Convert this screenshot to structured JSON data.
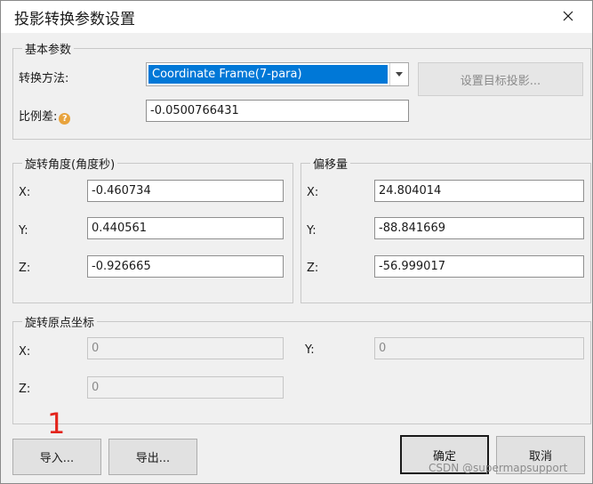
{
  "window": {
    "title": "投影转换参数设置"
  },
  "basic": {
    "legend": "基本参数",
    "method_label": "转换方法:",
    "method_value": "Coordinate Frame(7-para)",
    "scale_label": "比例差:",
    "scale_value": "-0.0500766431",
    "target_button": "设置目标投影..."
  },
  "rotation": {
    "legend": "旋转角度(角度秒)",
    "x_label": "X:",
    "x_value": "-0.460734",
    "y_label": "Y:",
    "y_value": "0.440561",
    "z_label": "Z:",
    "z_value": "-0.926665"
  },
  "offset": {
    "legend": "偏移量",
    "x_label": "X:",
    "x_value": "24.804014",
    "y_label": "Y:",
    "y_value": "-88.841669",
    "z_label": "Z:",
    "z_value": "-56.999017"
  },
  "origin": {
    "legend": "旋转原点坐标",
    "x_label": "X:",
    "x_value": "0",
    "y_label": "Y:",
    "y_value": "0",
    "z_label": "Z:",
    "z_value": "0"
  },
  "footer": {
    "import": "导入...",
    "export": "导出...",
    "ok": "确定",
    "cancel": "取消"
  },
  "annotation": {
    "marker": "1"
  },
  "watermark": "CSDN @supermapsupport",
  "colors": {
    "selection": "#0078d7",
    "help_icon": "#e8a33d",
    "marker": "#e3241b"
  },
  "icons": {
    "close": "close-icon",
    "dropdown": "chevron-down-icon",
    "help": "help-icon"
  }
}
